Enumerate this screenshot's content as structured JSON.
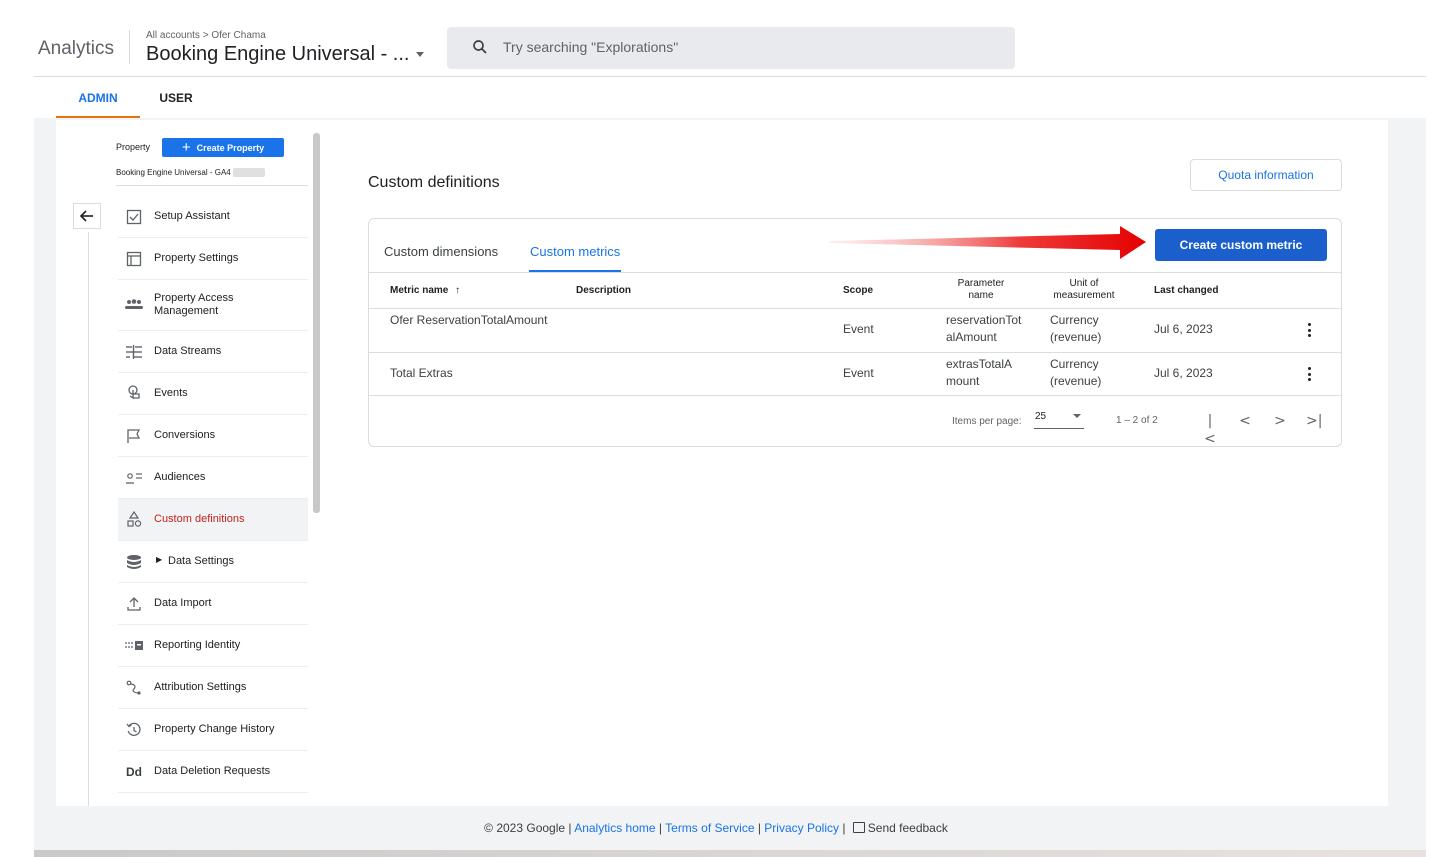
{
  "header": {
    "app_name": "Analytics",
    "breadcrumb": "All accounts > Ofer Chama",
    "property_title": "Booking Engine Universal - ...",
    "search_placeholder": "Try searching \"Explorations\""
  },
  "top_tabs": {
    "admin": "ADMIN",
    "user": "USER"
  },
  "sidebar": {
    "property_label": "Property",
    "create_property": "Create Property",
    "property_name": "Booking Engine Universal - GA4",
    "items": [
      {
        "label": "Setup Assistant",
        "icon": "checkbox-icon"
      },
      {
        "label": "Property Settings",
        "icon": "window-icon"
      },
      {
        "label": "Property Access\nManagement",
        "icon": "people-icon"
      },
      {
        "label": "Data Streams",
        "icon": "streams-icon"
      },
      {
        "label": "Events",
        "icon": "touch-icon"
      },
      {
        "label": "Conversions",
        "icon": "flag-icon"
      },
      {
        "label": "Audiences",
        "icon": "audience-icon"
      },
      {
        "label": "Custom definitions",
        "icon": "shapes-icon"
      },
      {
        "label": "Data Settings",
        "icon": "database-icon"
      },
      {
        "label": "Data Import",
        "icon": "upload-icon"
      },
      {
        "label": "Reporting Identity",
        "icon": "identity-icon"
      },
      {
        "label": "Attribution Settings",
        "icon": "attribution-icon"
      },
      {
        "label": "Property Change History",
        "icon": "history-icon"
      },
      {
        "label": "Data Deletion Requests",
        "icon": "dd-icon"
      }
    ]
  },
  "main": {
    "title": "Custom definitions",
    "quota_button": "Quota information",
    "tabs": {
      "dimensions": "Custom dimensions",
      "metrics": "Custom metrics"
    },
    "create_button": "Create custom metric",
    "columns": {
      "metric_name": "Metric name",
      "description": "Description",
      "scope": "Scope",
      "parameter_name": "Parameter name",
      "unit": "Unit of measurement",
      "last_changed": "Last changed"
    },
    "rows": [
      {
        "name": "Ofer ReservationTotalAmount",
        "description": "",
        "scope": "Event",
        "parameter": "reservationTotalAmount",
        "unit": "Currency (revenue)",
        "last_changed": "Jul 6, 2023"
      },
      {
        "name": "Total Extras",
        "description": "",
        "scope": "Event",
        "parameter": "extrasTotalAmount",
        "unit": "Currency (revenue)",
        "last_changed": "Jul 6, 2023"
      }
    ],
    "pagination": {
      "label": "Items per page:",
      "page_size": "25",
      "range": "1 – 2 of 2"
    }
  },
  "footer": {
    "copyright": "© 2023 Google |",
    "analytics_home": "Analytics home",
    "terms": "Terms of Service",
    "privacy": "Privacy Policy",
    "feedback": "Send feedback"
  },
  "colors": {
    "primary": "#1a73e8",
    "button_blue": "#1a5fcc",
    "active_red": "#c5221f",
    "admin_underline": "#e8710a"
  }
}
